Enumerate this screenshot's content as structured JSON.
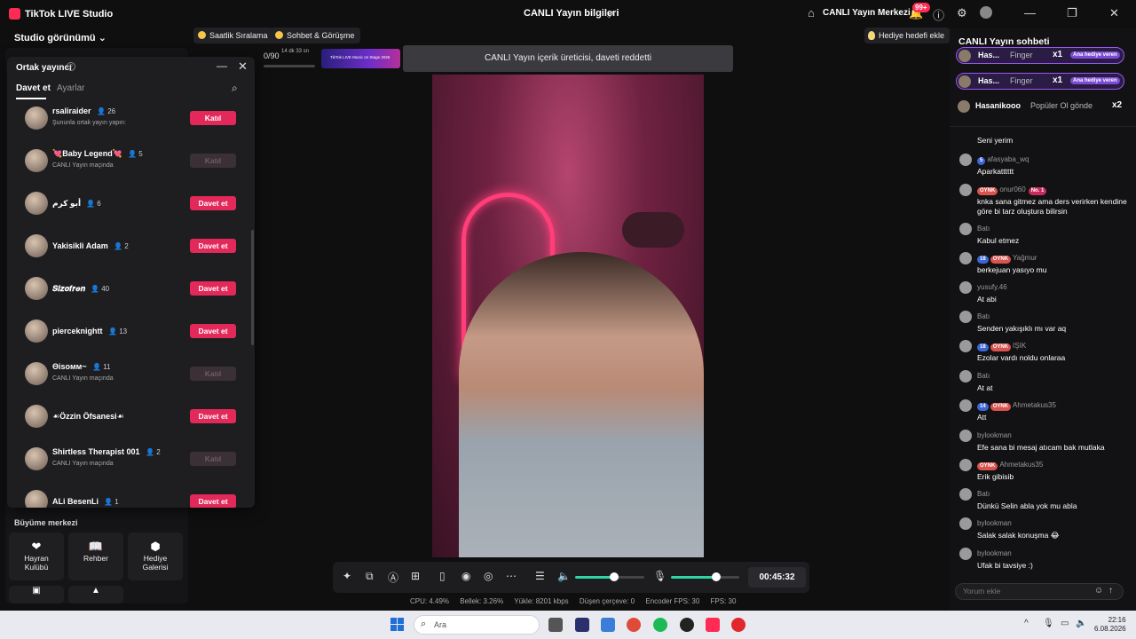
{
  "titlebar": {
    "app_title": "TikTok LIVE Studio",
    "center_title": "CANLI Yayın bilgileri",
    "live_center": "CANLI Yayın Merkezi",
    "notif_badge": "99+"
  },
  "studio": {
    "view_label": "Studio görünümü"
  },
  "chips": {
    "hourly_ranking": "Saatlik Sıralama",
    "chat_meet": "Sohbet & Görüşme",
    "gift_goal": "Hediye hedefi ekle"
  },
  "progress": {
    "value": "0/90",
    "timer": "14 dk 33 sn"
  },
  "banner": {
    "text": "TikTok LIVE Music on Stage 2026"
  },
  "toast": "CANLI Yayın içerik üreticisi, daveti reddetti",
  "cohost": {
    "title": "Ortak yayıncı",
    "tabs": [
      "Davet et",
      "Ayarlar"
    ],
    "rows": [
      {
        "name": "rsaliraider",
        "count": "26",
        "sub": "Şununla ortak yayın yapın:",
        "button": "Katıl",
        "enabled": true
      },
      {
        "name": "💘Baby Legend💘",
        "count": "5",
        "sub": "CANLI Yayın maçında",
        "button": "Katıl",
        "enabled": false
      },
      {
        "name": "أبو كرم",
        "count": "6",
        "sub": "",
        "button": "Davet et",
        "enabled": true
      },
      {
        "name": "Yakisikli Adam",
        "count": "2",
        "sub": "",
        "button": "Davet et",
        "enabled": true
      },
      {
        "name": "𝑺𝒊𝒛𝒐𝒇𝒓𝒆𝒏",
        "count": "40",
        "sub": "",
        "button": "Davet et",
        "enabled": true
      },
      {
        "name": "pierceknightt",
        "count": "13",
        "sub": "",
        "button": "Davet et",
        "enabled": true
      },
      {
        "name": "Θisoмм~",
        "count": "11",
        "sub": "CANLI Yayın maçında",
        "button": "Katıl",
        "enabled": false
      },
      {
        "name": "☙Özzin Öfsanesi☙",
        "count": "",
        "sub": "",
        "button": "Davet et",
        "enabled": true
      },
      {
        "name": "Shirtless Therapist 001",
        "count": "2",
        "sub": "CANLI Yayın maçında",
        "button": "Katıl",
        "enabled": false
      },
      {
        "name": "ALi BesenLi",
        "count": "1",
        "sub": "",
        "button": "Davet et",
        "enabled": true
      }
    ]
  },
  "growth": {
    "title": "Büyüme merkezi",
    "tiles": [
      {
        "label1": "Hayran",
        "label2": "Kulübü",
        "icon": "heart-icon"
      },
      {
        "label1": "Rehber",
        "label2": "",
        "icon": "book-icon"
      },
      {
        "label1": "Hediye",
        "label2": "Galerisi",
        "icon": "gift-icon"
      }
    ]
  },
  "controls": {
    "timer": "00:45:32"
  },
  "stats": {
    "cpu": "CPU: 4.49%",
    "memory": "Bellek: 3.26%",
    "upload": "Yükle: 8201 kbps",
    "dropped": "Düşen çerçeve: 0",
    "encoder_fps": "Encoder FPS: 30",
    "fps": "FPS: 30"
  },
  "chat": {
    "title": "CANLI Yayın sohbeti",
    "gifts": [
      {
        "name": "Has...",
        "gift": "Finger",
        "mult": "x1",
        "badge": "Ana hediye veren"
      },
      {
        "name": "Has...",
        "gift": "Finger",
        "mult": "x1",
        "badge": "Ana hediye veren"
      },
      {
        "name": "Hasanikooo",
        "gift": "Popüler Ol gönde",
        "mult": "x2"
      }
    ],
    "messages": [
      {
        "user": "",
        "text": "Seni yerim"
      },
      {
        "level": "5",
        "user": "afasyaba_wq",
        "text": "Aparkatttttt"
      },
      {
        "oynk": "OYNK",
        "no1": "No. 1",
        "user": "onur060",
        "text": "knka sana gitmez ama ders verirken kendine göre bi tarz oluştura bilirsin"
      },
      {
        "user": "Batı",
        "text": "Kabul etmez"
      },
      {
        "level": "18",
        "oynk": "OYNK",
        "user": "Yağmur",
        "text": "berkejuan yasıyo mu"
      },
      {
        "user": "yusufy.46",
        "text": "At abi"
      },
      {
        "user": "Batı",
        "text": "Senden yakışıklı mı var aq"
      },
      {
        "level": "18",
        "oynk": "OYNK",
        "user": "IŞIK",
        "text": "Ezolar vardı noldu onlaraa"
      },
      {
        "user": "Batı",
        "text": "At at"
      },
      {
        "level": "14",
        "oynk": "OYNK",
        "user": "Ahmetakus35",
        "text": "Att"
      },
      {
        "user": "bylookman",
        "text": "Efe sana bi mesaj atıcam bak mutlaka"
      },
      {
        "oynk": "OYNK",
        "user": "Ahmetakus35",
        "text": "Erik gibisib"
      },
      {
        "user": "Batı",
        "text": "Dünkü Selin abla yok mu abla"
      },
      {
        "user": "bylookman",
        "text": "Salak salak konuşma 😂"
      },
      {
        "user": "bylookman",
        "text": "Ufak bi tavsiye :)"
      }
    ],
    "comment_placeholder": "Yorum ekle"
  },
  "taskbar": {
    "search": "Ara",
    "time": "22:16",
    "date": "6.08.2026"
  },
  "colors": {
    "accent": "#e3285a",
    "chat_bg": "#121214",
    "bg": "#0f0f10"
  }
}
